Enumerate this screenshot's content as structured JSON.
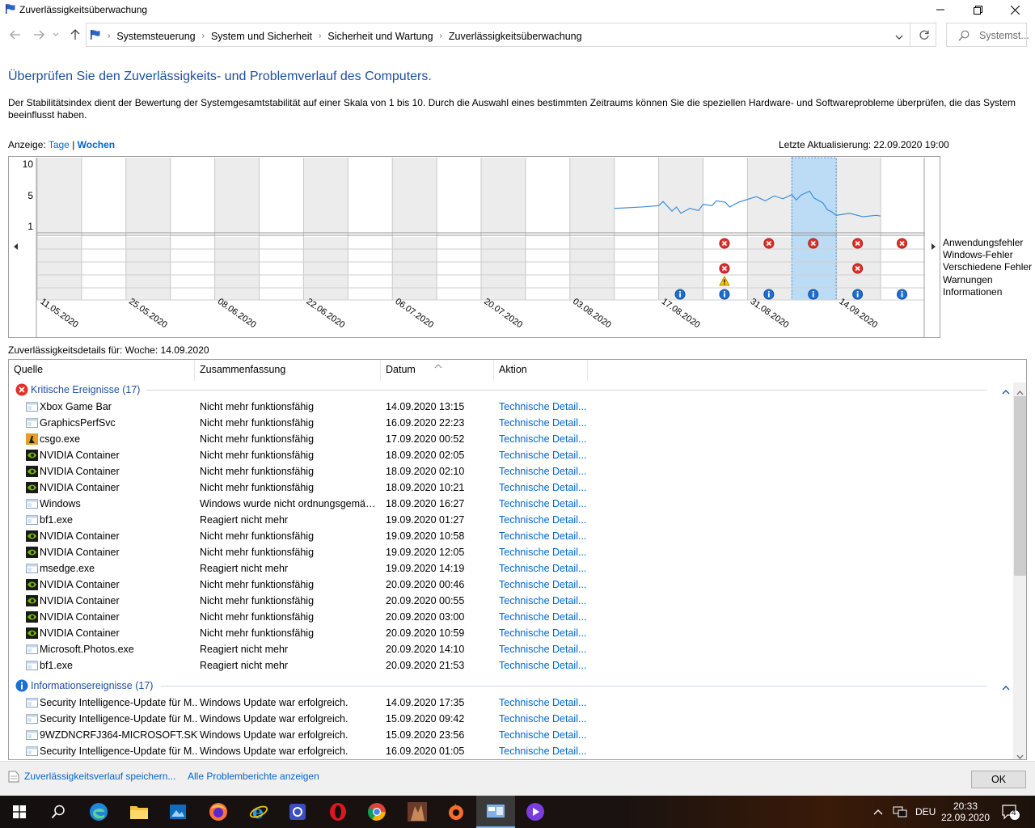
{
  "window": {
    "title": "Zuverlässigkeitsüberwachung"
  },
  "breadcrumb": [
    "Systemsteuerung",
    "System und Sicherheit",
    "Sicherheit und Wartung",
    "Zuverlässigkeitsüberwachung"
  ],
  "search": {
    "placeholder": "Systemst..."
  },
  "heading": "Überprüfen Sie den Zuverlässigkeits- und Problemverlauf des Computers.",
  "description": "Der Stabilitätsindex dient der Bewertung der Systemgesamtstabilität auf einer Skala von 1 bis 10. Durch die Auswahl eines bestimmten Zeitraums können Sie die speziellen Hardware- und Softwareprobleme überprüfen, die das System beeinflusst haben.",
  "view": {
    "label": "Anzeige:",
    "days": "Tage",
    "sep": "|",
    "weeks": "Wochen"
  },
  "last_update": "Letzte Aktualisierung: 22.09.2020 19:00",
  "chart_data": {
    "type": "line",
    "y_ticks": [
      "10",
      "5",
      "1"
    ],
    "ylim": [
      1,
      10
    ],
    "columns": 20,
    "selected_column": 18,
    "x_labels": [
      {
        "col": 1,
        "label": "11.05.2020"
      },
      {
        "col": 3,
        "label": "25.05.2020"
      },
      {
        "col": 5,
        "label": "08.06.2020"
      },
      {
        "col": 7,
        "label": "22.06.2020"
      },
      {
        "col": 9,
        "label": "06.07.2020"
      },
      {
        "col": 11,
        "label": "20.07.2020"
      },
      {
        "col": 13,
        "label": "03.08.2020"
      },
      {
        "col": 15,
        "label": "17.08.2020"
      },
      {
        "col": 17,
        "label": "31.08.2020"
      },
      {
        "col": 19,
        "label": "14.09.2020"
      }
    ],
    "stability": [
      [
        14.0,
        3.6
      ],
      [
        14.6,
        3.8
      ],
      [
        15.0,
        4.0
      ],
      [
        15.1,
        4.6
      ],
      [
        15.3,
        3.2
      ],
      [
        15.4,
        3.8
      ],
      [
        15.5,
        2.9
      ],
      [
        15.7,
        3.6
      ],
      [
        15.9,
        3.3
      ],
      [
        16.0,
        4.2
      ],
      [
        16.2,
        4.0
      ],
      [
        16.3,
        4.7
      ],
      [
        16.5,
        4.5
      ],
      [
        16.6,
        3.8
      ],
      [
        16.8,
        4.5
      ],
      [
        17.0,
        4.9
      ],
      [
        17.2,
        5.3
      ],
      [
        17.4,
        4.7
      ],
      [
        17.6,
        5.4
      ],
      [
        17.8,
        5.0
      ],
      [
        18.0,
        5.6
      ],
      [
        18.1,
        4.8
      ],
      [
        18.2,
        5.5
      ],
      [
        18.4,
        6.1
      ],
      [
        18.5,
        5.1
      ],
      [
        18.7,
        4.4
      ],
      [
        18.8,
        3.4
      ],
      [
        18.9,
        3.1
      ],
      [
        19.0,
        2.6
      ],
      [
        19.3,
        2.9
      ],
      [
        19.6,
        2.4
      ],
      [
        19.9,
        2.6
      ],
      [
        20.0,
        2.5
      ]
    ],
    "row_labels": [
      "Anwendungsfehler",
      "Windows-Fehler",
      "Verschiedene Fehler",
      "Warnungen",
      "Informationen"
    ],
    "markers": [
      {
        "row": 0,
        "col": 16,
        "kind": "error"
      },
      {
        "row": 0,
        "col": 17,
        "kind": "error"
      },
      {
        "row": 0,
        "col": 18,
        "kind": "error"
      },
      {
        "row": 0,
        "col": 19,
        "kind": "error"
      },
      {
        "row": 0,
        "col": 20,
        "kind": "error"
      },
      {
        "row": 2,
        "col": 16,
        "kind": "error"
      },
      {
        "row": 2,
        "col": 19,
        "kind": "error"
      },
      {
        "row": 3,
        "col": 16,
        "kind": "warning"
      },
      {
        "row": 4,
        "col": 15,
        "kind": "info"
      },
      {
        "row": 4,
        "col": 16,
        "kind": "info"
      },
      {
        "row": 4,
        "col": 17,
        "kind": "info"
      },
      {
        "row": 4,
        "col": 18,
        "kind": "info"
      },
      {
        "row": 4,
        "col": 19,
        "kind": "info"
      },
      {
        "row": 4,
        "col": 20,
        "kind": "info"
      }
    ]
  },
  "details_label": "Zuverlässigkeitsdetails für: Woche: 14.09.2020",
  "columns": {
    "source": "Quelle",
    "summary": "Zusammenfassung",
    "date": "Datum",
    "action": "Aktion"
  },
  "groups": [
    {
      "label": "Kritische Ereignisse (17)",
      "icon": "error",
      "rows": [
        {
          "src": "Xbox Game Bar",
          "icon": "app",
          "sum": "Nicht mehr funktionsfähig",
          "date": "14.09.2020 13:15",
          "act": "Technische Detail..."
        },
        {
          "src": "GraphicsPerfSvc",
          "icon": "app",
          "sum": "Nicht mehr funktionsfähig",
          "date": "16.09.2020 22:23",
          "act": "Technische Detail..."
        },
        {
          "src": "csgo.exe",
          "icon": "csgo",
          "sum": "Nicht mehr funktionsfähig",
          "date": "17.09.2020 00:52",
          "act": "Technische Detail..."
        },
        {
          "src": "NVIDIA Container",
          "icon": "nvidia",
          "sum": "Nicht mehr funktionsfähig",
          "date": "18.09.2020 02:05",
          "act": "Technische Detail..."
        },
        {
          "src": "NVIDIA Container",
          "icon": "nvidia",
          "sum": "Nicht mehr funktionsfähig",
          "date": "18.09.2020 02:10",
          "act": "Technische Detail..."
        },
        {
          "src": "NVIDIA Container",
          "icon": "nvidia",
          "sum": "Nicht mehr funktionsfähig",
          "date": "18.09.2020 10:21",
          "act": "Technische Detail..."
        },
        {
          "src": "Windows",
          "icon": "app",
          "sum": "Windows wurde nicht ordnungsgemäß ...",
          "date": "18.09.2020 16:27",
          "act": "Technische Detail..."
        },
        {
          "src": "bf1.exe",
          "icon": "app",
          "sum": "Reagiert nicht mehr",
          "date": "19.09.2020 01:27",
          "act": "Technische Detail..."
        },
        {
          "src": "NVIDIA Container",
          "icon": "nvidia",
          "sum": "Nicht mehr funktionsfähig",
          "date": "19.09.2020 10:58",
          "act": "Technische Detail..."
        },
        {
          "src": "NVIDIA Container",
          "icon": "nvidia",
          "sum": "Nicht mehr funktionsfähig",
          "date": "19.09.2020 12:05",
          "act": "Technische Detail..."
        },
        {
          "src": "msedge.exe",
          "icon": "app",
          "sum": "Reagiert nicht mehr",
          "date": "19.09.2020 14:19",
          "act": "Technische Detail..."
        },
        {
          "src": "NVIDIA Container",
          "icon": "nvidia",
          "sum": "Nicht mehr funktionsfähig",
          "date": "20.09.2020 00:46",
          "act": "Technische Detail..."
        },
        {
          "src": "NVIDIA Container",
          "icon": "nvidia",
          "sum": "Nicht mehr funktionsfähig",
          "date": "20.09.2020 00:55",
          "act": "Technische Detail..."
        },
        {
          "src": "NVIDIA Container",
          "icon": "nvidia",
          "sum": "Nicht mehr funktionsfähig",
          "date": "20.09.2020 03:00",
          "act": "Technische Detail..."
        },
        {
          "src": "NVIDIA Container",
          "icon": "nvidia",
          "sum": "Nicht mehr funktionsfähig",
          "date": "20.09.2020 10:59",
          "act": "Technische Detail..."
        },
        {
          "src": "Microsoft.Photos.exe",
          "icon": "app",
          "sum": "Reagiert nicht mehr",
          "date": "20.09.2020 14:10",
          "act": "Technische Detail..."
        },
        {
          "src": "bf1.exe",
          "icon": "app",
          "sum": "Reagiert nicht mehr",
          "date": "20.09.2020 21:53",
          "act": "Technische Detail..."
        }
      ]
    },
    {
      "label": "Informationsereignisse (17)",
      "icon": "info",
      "rows": [
        {
          "src": "Security Intelligence-Update für M...",
          "icon": "app",
          "sum": "Windows Update war erfolgreich.",
          "date": "14.09.2020 17:35",
          "act": "Technische Detail..."
        },
        {
          "src": "Security Intelligence-Update für M...",
          "icon": "app",
          "sum": "Windows Update war erfolgreich.",
          "date": "15.09.2020 09:42",
          "act": "Technische Detail..."
        },
        {
          "src": "9WZDNCRFJ364-MICROSOFT.SKY...",
          "icon": "app",
          "sum": "Windows Update war erfolgreich.",
          "date": "15.09.2020 23:56",
          "act": "Technische Detail..."
        },
        {
          "src": "Security Intelligence-Update für M...",
          "icon": "app",
          "sum": "Windows Update war erfolgreich.",
          "date": "16.09.2020 01:05",
          "act": "Technische Detail..."
        }
      ]
    }
  ],
  "footer": {
    "save_link": "Zuverlässigkeitsverlauf speichern...",
    "all_reports_link": "Alle Problemberichte anzeigen",
    "ok": "OK"
  },
  "taskbar": {
    "language": "DEU",
    "time": "20:33",
    "date": "22.09.2020",
    "notifications": "4"
  }
}
